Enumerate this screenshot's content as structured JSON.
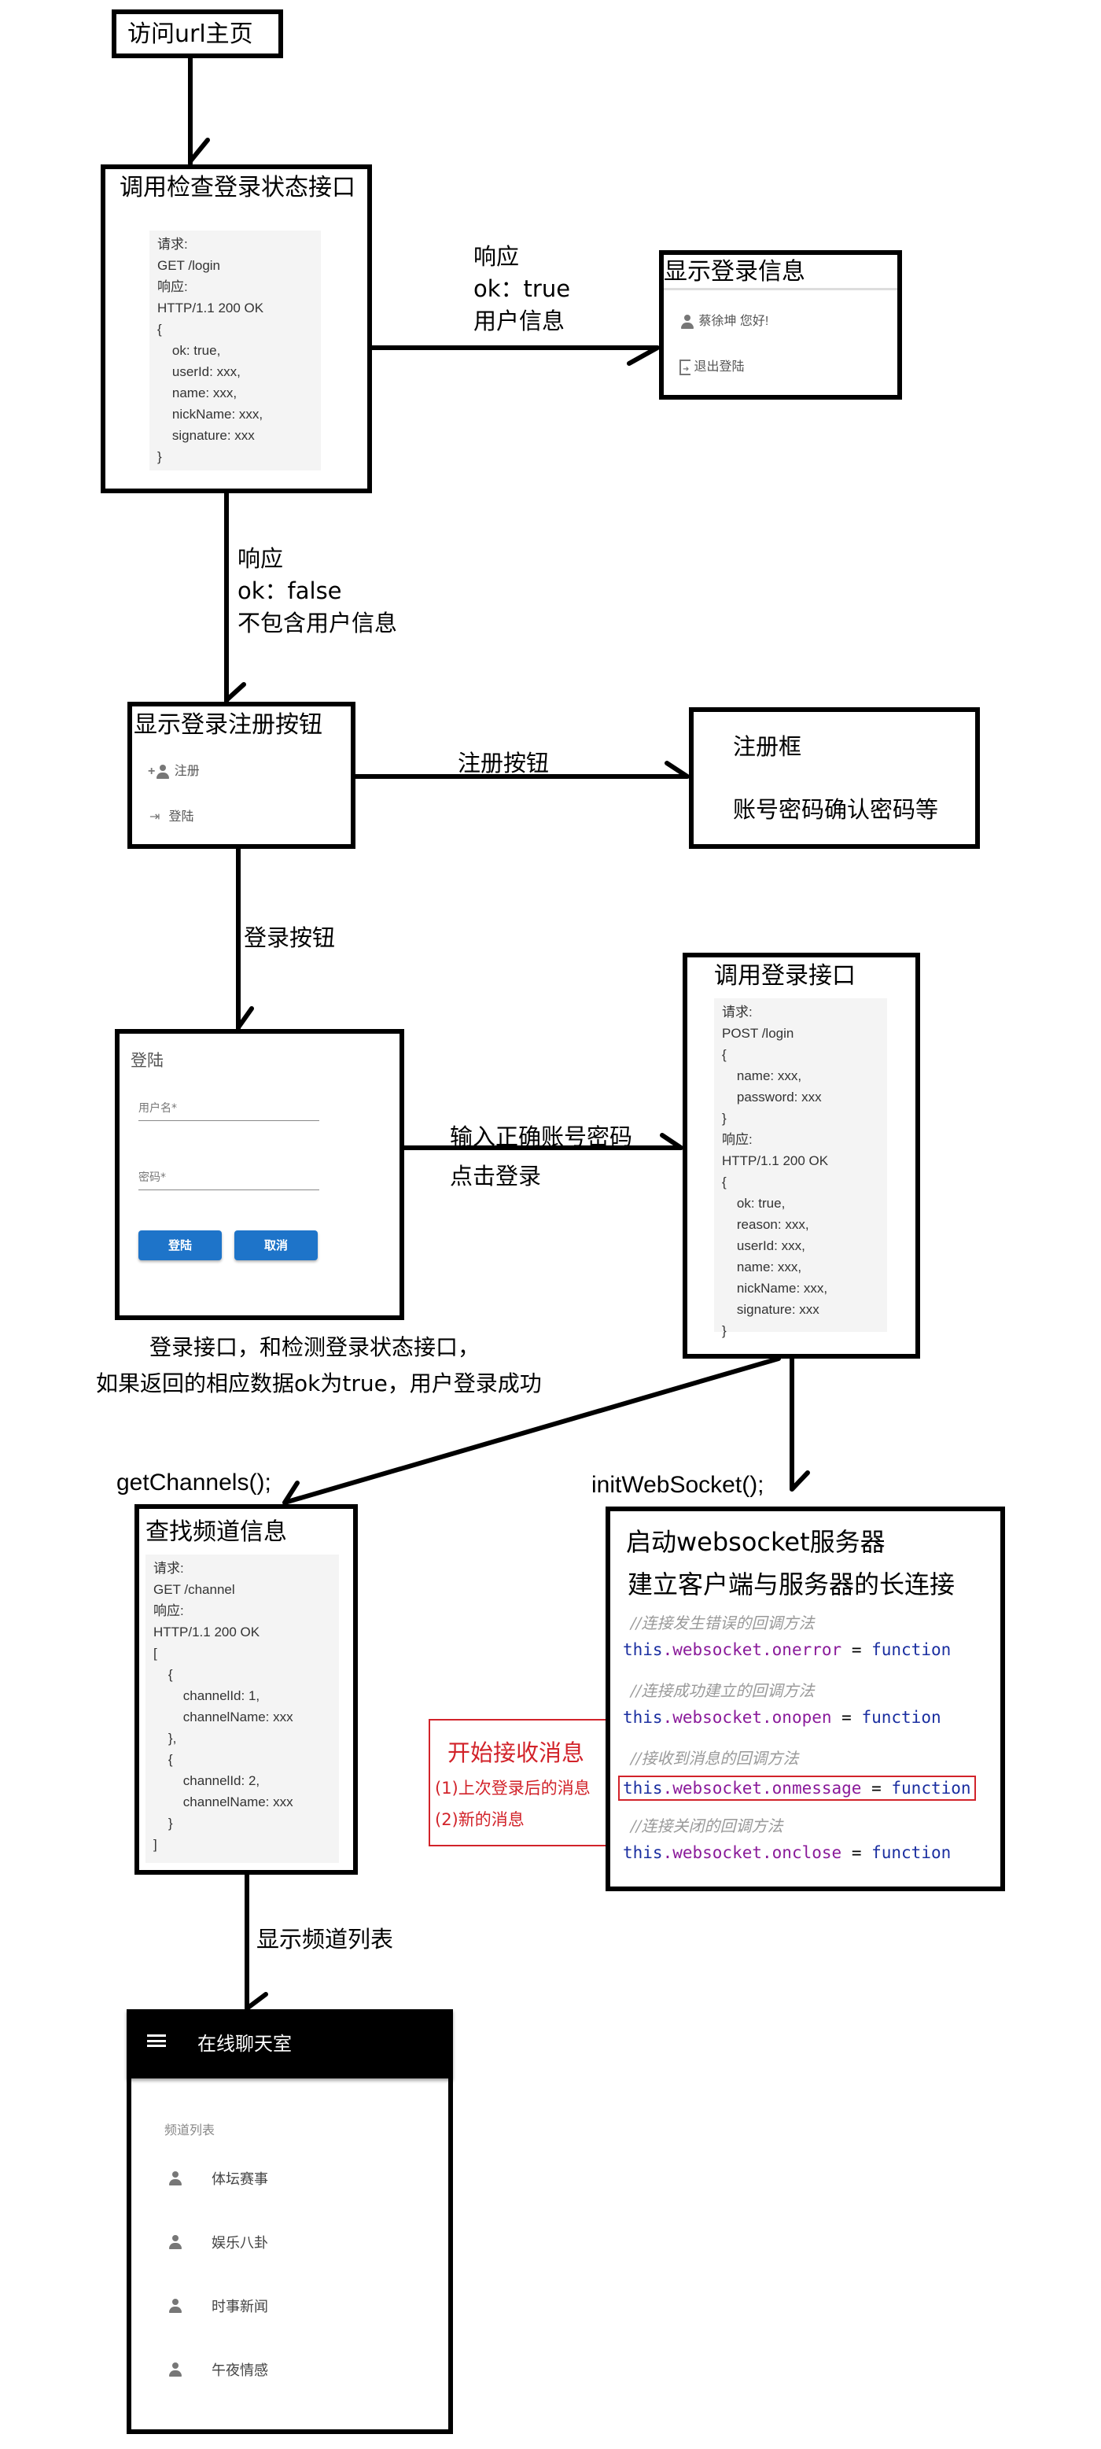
{
  "nodes": {
    "visit_home": {
      "title": "访问url主页"
    },
    "check_login": {
      "title": "调用检查登录状态接口",
      "code": [
        "请求:",
        "GET /login",
        "响应:",
        "HTTP/1.1 200 OK",
        "{",
        "    ok: true,",
        "    userId: xxx,",
        "    name: xxx,",
        "    nickName: xxx,",
        "    signature: xxx",
        "}"
      ]
    },
    "show_login_info": {
      "title": "显示登录信息",
      "user_greeting": "蔡徐坤 您好!",
      "logout_label": "退出登陆"
    },
    "show_buttons": {
      "title": "显示登录注册按钮",
      "register_label": "注册",
      "login_label": "登陆"
    },
    "register_box": {
      "title": "注册框",
      "subtitle": "账号密码确认密码等"
    },
    "login_dialog": {
      "title": "登陆",
      "username_placeholder": "用户名*",
      "password_placeholder": "密码*",
      "login_button": "登陆",
      "cancel_button": "取消"
    },
    "login_api": {
      "title": "调用登录接口",
      "code": [
        "请求:",
        "POST /login",
        "{",
        "    name: xxx,",
        "    password: xxx",
        "}",
        "响应:",
        "HTTP/1.1 200 OK",
        "{",
        "    ok: true,",
        "    reason: xxx,",
        "    userId: xxx,",
        "    name: xxx,",
        "    nickName: xxx,",
        "    signature: xxx",
        "}"
      ]
    },
    "channel_info": {
      "title": "查找频道信息",
      "code": [
        "请求:",
        "GET /channel",
        "响应:",
        "HTTP/1.1 200 OK",
        "[",
        "    {",
        "        channelId: 1,",
        "        channelName: xxx",
        "    },",
        "    {",
        "        channelId: 2,",
        "        channelName: xxx",
        "    }",
        "]"
      ]
    },
    "websocket": {
      "title": "启动websocket服务器",
      "subtitle": "建立客户端与服务器的长连接",
      "handlers": [
        {
          "comment": "//连接发生错误的回调方法",
          "this": "this",
          "obj": ".websocket",
          "prop": ".onerror",
          "eq": " = ",
          "fn": "function",
          "highlighted": false
        },
        {
          "comment": "//连接成功建立的回调方法",
          "this": "this",
          "obj": ".websocket",
          "prop": ".onopen",
          "eq": " = ",
          "fn": "function",
          "highlighted": false
        },
        {
          "comment": "//接收到消息的回调方法",
          "this": "this",
          "obj": ".websocket",
          "prop": ".onmessage",
          "eq": " = ",
          "fn": "function",
          "highlighted": true
        },
        {
          "comment": "//连接关闭的回调方法",
          "this": "this",
          "obj": ".websocket",
          "prop": ".onclose",
          "eq": " = ",
          "fn": "function",
          "highlighted": false
        }
      ]
    },
    "receive_note": {
      "title": "开始接收消息",
      "lines": [
        "(1)上次登录后的消息",
        "(2)新的消息"
      ]
    },
    "chat_app": {
      "app_title": "在线聊天室",
      "section_label": "频道列表",
      "channels": [
        "体坛赛事",
        "娱乐八卦",
        "时事新闻",
        "午夜情感"
      ]
    }
  },
  "edges": {
    "ok_true": [
      "响应",
      "ok：true",
      "用户信息"
    ],
    "ok_false": [
      "响应",
      "ok：false",
      "不包含用户信息"
    ],
    "register_button": "注册按钮",
    "login_button": "登录按钮",
    "enter_credentials": [
      "输入正确账号密码",
      "点击登录"
    ],
    "success_note": [
      "登录接口，和检测登录状态接口，",
      "如果返回的相应数据ok为true，用户登录成功"
    ],
    "get_channels": "getChannels();",
    "init_websocket": "initWebSocket();",
    "show_channel_list": "显示频道列表"
  },
  "colors": {
    "highlight_red": "#d2232a",
    "button_blue": "#1e74c9",
    "code_bg": "#f4f4f4"
  }
}
